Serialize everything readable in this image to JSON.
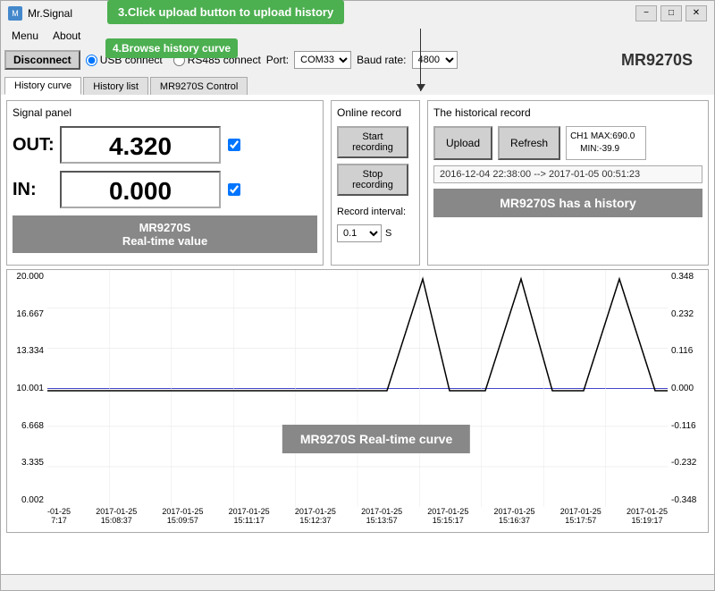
{
  "tooltip": {
    "text": "3.Click upload button to upload history"
  },
  "browse_label": "4.Browse history curve",
  "title_bar": {
    "icon": "M",
    "title": "Mr.Signal",
    "min": "−",
    "max": "□",
    "close": "✕"
  },
  "menu": {
    "items": [
      "Menu",
      "About"
    ]
  },
  "toolbar": {
    "disconnect": "Disconnect",
    "usb_connect": "USB connect",
    "rs485_connect": "RS485 connect",
    "port_label": "Port:",
    "port_value": "COM33",
    "baud_label": "Baud rate:",
    "baud_value": "4800",
    "device": "MR9270S"
  },
  "tabs": [
    "History curve",
    "History list",
    "MR9270S Control"
  ],
  "signal_panel": {
    "title": "Signal panel",
    "out_label": "OUT:",
    "out_value": "4.320",
    "in_label": "IN:",
    "in_value": "0.000",
    "realtime": "MR9270S\nReal-time value"
  },
  "record_panel": {
    "title": "Online record",
    "start_btn": "Start\nrecording",
    "stop_btn": "Stop\nrecording",
    "interval_label": "Record interval:",
    "interval_value": "0.1",
    "interval_unit": "S"
  },
  "history_panel": {
    "title": "The historical record",
    "upload_btn": "Upload",
    "refresh_btn": "Refresh",
    "ch_info": "CH1 MAX:690.0\n    MIN:-39.9",
    "date_range": "2016-12-04 22:38:00 --> 2017-01-05 00:51:23",
    "status": "MR9270S has a history"
  },
  "chart": {
    "y_left": [
      "20.000",
      "16.667",
      "13.334",
      "10.001",
      "6.668",
      "3.335",
      "0.002"
    ],
    "y_right": [
      "0.348",
      "0.232",
      "0.116",
      "0.000",
      "-0.116",
      "-0.232",
      "-0.348"
    ],
    "x_labels": [
      {
        "line1": "-01-25",
        "line2": "7:17"
      },
      {
        "line1": "2017-01-25",
        "line2": "15:08:37"
      },
      {
        "line1": "2017-01-25",
        "line2": "15:09:57"
      },
      {
        "line1": "2017-01-25",
        "line2": "15:11:17"
      },
      {
        "line1": "2017-01-25",
        "line2": "15:12:37"
      },
      {
        "line1": "2017-01-25",
        "line2": "15:13:57"
      },
      {
        "line1": "2017-01-25",
        "line2": "15:15:17"
      },
      {
        "line1": "2017-01-25",
        "line2": "15:16:37"
      },
      {
        "line1": "2017-01-25",
        "line2": "15:17:57"
      },
      {
        "line1": "2017-01-25",
        "line2": "15:19:17"
      }
    ],
    "label": "MR9270S Real-time curve"
  },
  "status_bar": {
    "text": ""
  }
}
